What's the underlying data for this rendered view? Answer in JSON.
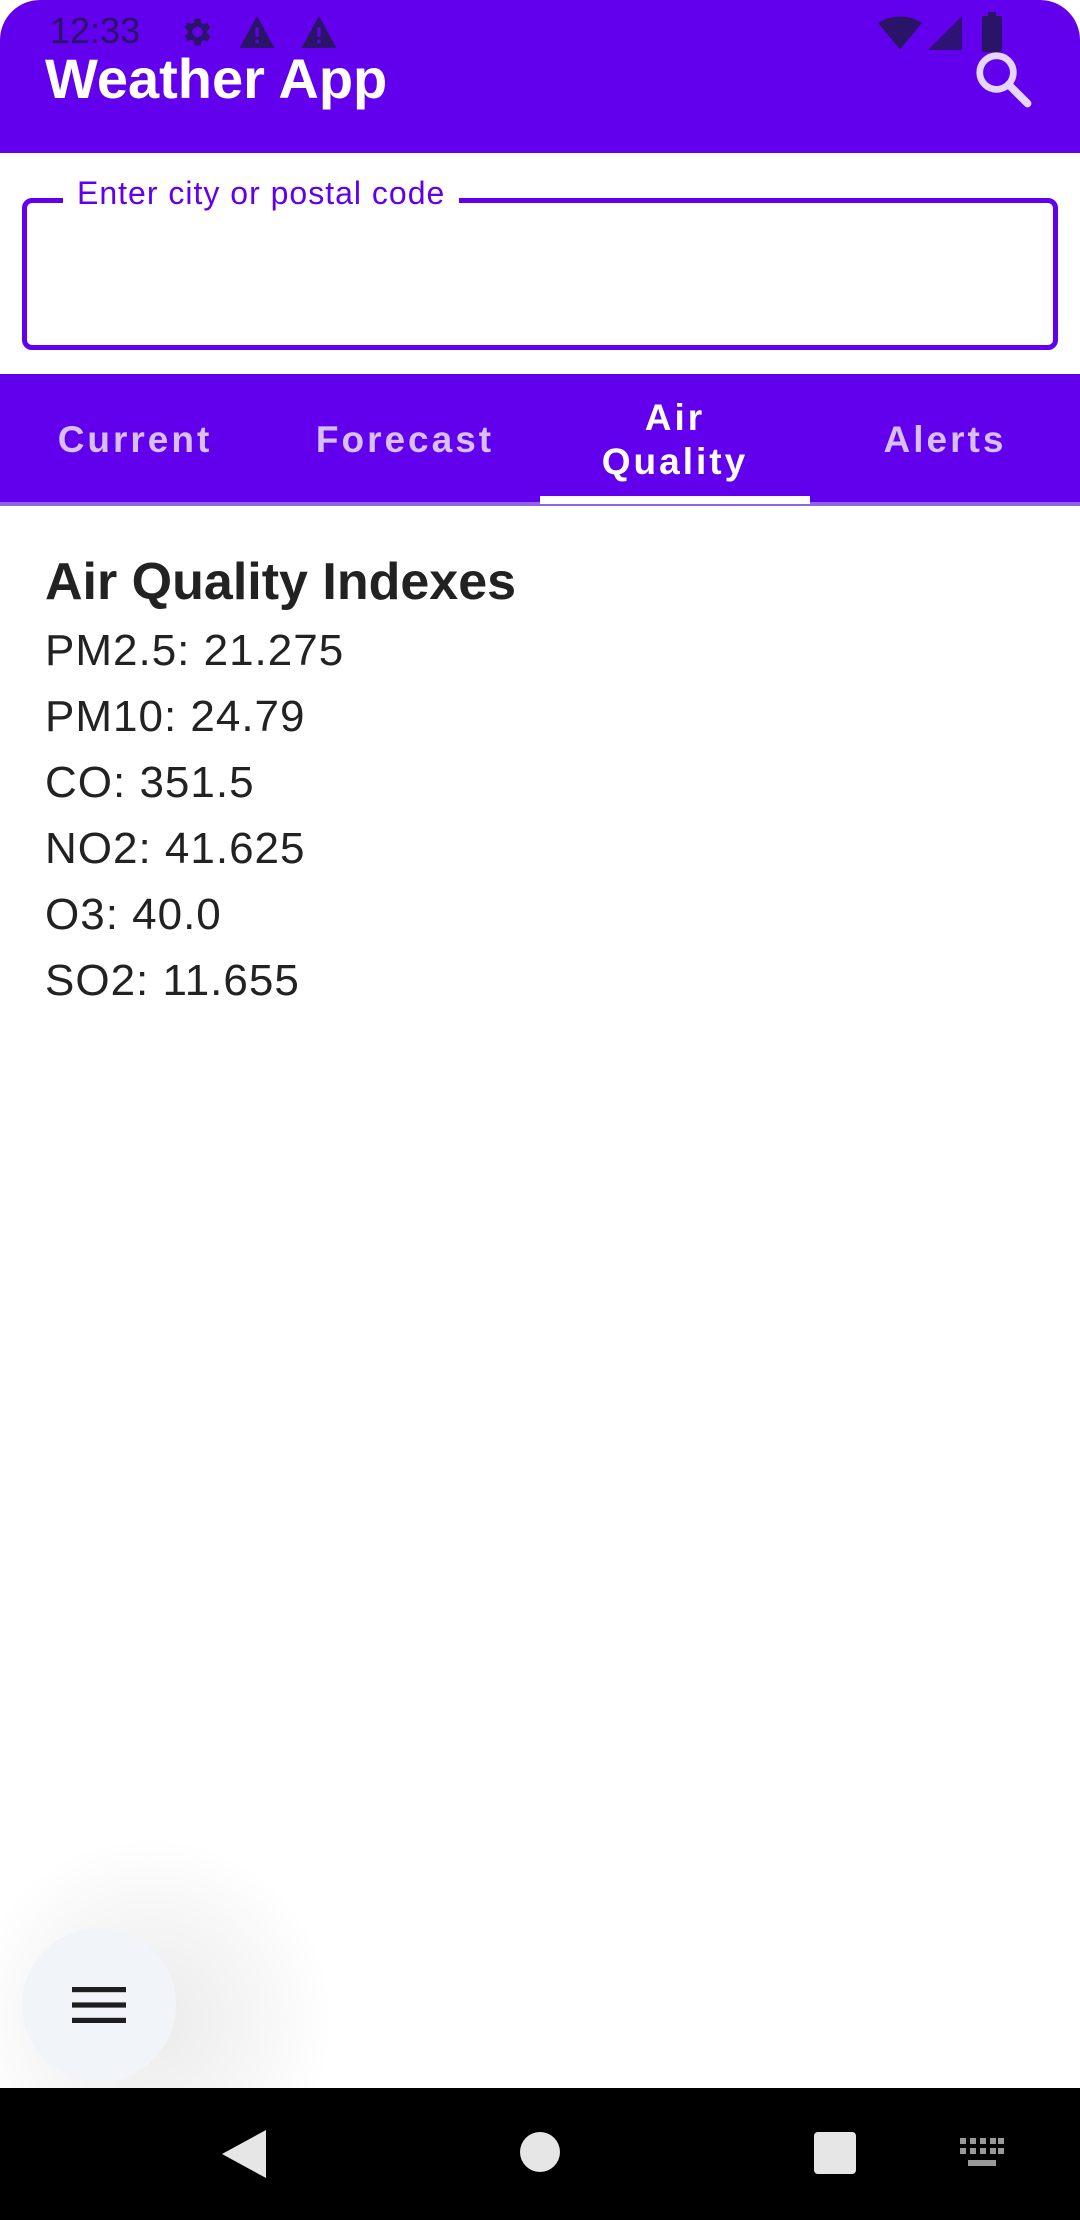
{
  "status_bar": {
    "time": "12:33",
    "icons_left": [
      "gear-icon",
      "warning-icon",
      "warning-icon"
    ],
    "icons_right": [
      "wifi-icon",
      "signal-icon",
      "battery-icon"
    ]
  },
  "app_bar": {
    "title": "Weather App",
    "action_icon": "search-icon"
  },
  "search": {
    "label": "Enter city or postal code",
    "value": ""
  },
  "tabs": {
    "items": [
      {
        "label": "Current"
      },
      {
        "label": "Forecast"
      },
      {
        "label": "Air Quality"
      },
      {
        "label": "Alerts"
      }
    ],
    "selected": "Air Quality"
  },
  "air_quality": {
    "heading": "Air Quality Indexes",
    "items": [
      "PM2.5: 21.275",
      "PM10: 24.79",
      "CO: 351.5",
      "NO2: 41.625",
      "O3: 40.0",
      "SO2: 11.655"
    ]
  },
  "fab": {
    "icon": "menu-icon"
  },
  "nav_bar": {
    "icons": [
      "back-icon",
      "home-icon",
      "recents-icon",
      "keyboard-icon"
    ]
  },
  "colors": {
    "primary": "#6200ee",
    "text": "#222222",
    "fab_bg": "#f1f5fa"
  }
}
